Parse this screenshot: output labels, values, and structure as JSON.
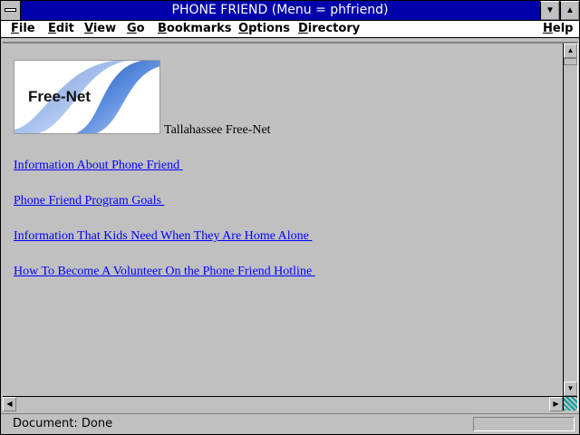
{
  "window": {
    "title": "PHONE FRIEND (Menu = phfriend)",
    "minimize_glyph": "▼",
    "maximize_glyph": "▲"
  },
  "menu": [
    {
      "label": "File"
    },
    {
      "label": "Edit"
    },
    {
      "label": "View"
    },
    {
      "label": "Go"
    },
    {
      "label": "Bookmarks"
    },
    {
      "label": "Options"
    },
    {
      "label": "Directory"
    },
    {
      "label": "Help"
    }
  ],
  "page": {
    "logo_text": "Free-Net",
    "logo_caption": "Tallahassee Free-Net",
    "links": [
      {
        "label": "Information About Phone Friend "
      },
      {
        "label": "Phone Friend Program Goals "
      },
      {
        "label": "Information That Kids Need When They Are Home Alone "
      },
      {
        "label": "How To Become A Volunteer On the Phone Friend Hotline "
      }
    ]
  },
  "scrollbar": {
    "up_glyph": "▲",
    "down_glyph": "▼",
    "left_glyph": "◀",
    "right_glyph": "▶"
  },
  "status": {
    "text": "Document: Done"
  },
  "colors": {
    "titlebar": "#0000aa",
    "link": "#0000ff",
    "chrome": "#c0c0c0",
    "logo_swoosh": "#1a55b8"
  }
}
